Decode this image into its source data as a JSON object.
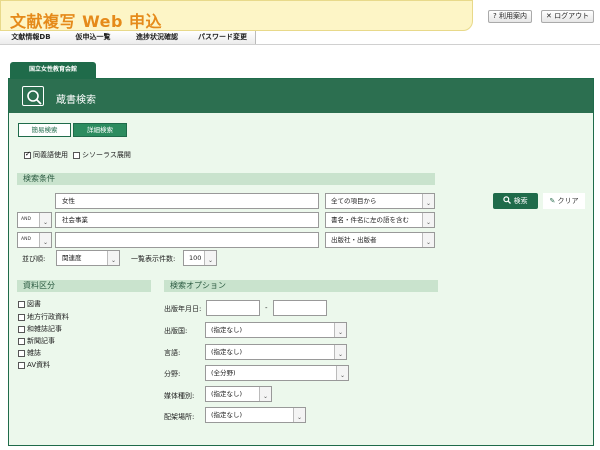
{
  "header": {
    "title": "文献複写 Web 申込",
    "help_label": "利用案内",
    "logout_label": "ログアウト"
  },
  "nav": {
    "items": [
      {
        "label": "文献情報DB"
      },
      {
        "label": "仮申込一覧"
      },
      {
        "label": "進捗状況確認"
      },
      {
        "label": "パスワード変更"
      }
    ]
  },
  "library_tab": "国立女性教育会館",
  "panel_title": "蔵書検索",
  "mode": {
    "simple_label": "簡易検索",
    "advanced_label": "詳細検索",
    "active": "advanced"
  },
  "options": {
    "synonym_label": "同義語使用",
    "synonym_checked": true,
    "thesaurus_label": "シソーラス展開",
    "thesaurus_checked": false
  },
  "conditions": {
    "section_label": "検索条件",
    "rows": [
      {
        "operator": "",
        "value": "女性",
        "field": "全ての項目から"
      },
      {
        "operator": "AND",
        "value": "社会事業",
        "field": "書名・件名に左の語を含む"
      },
      {
        "operator": "AND",
        "value": "",
        "field": "出版社・出版者"
      }
    ],
    "sort_label": "並び順:",
    "sort_value": "関連度",
    "count_label": "一覧表示件数:",
    "count_value": "100",
    "search_label": "検索",
    "clear_label": "クリア"
  },
  "material": {
    "section_label": "資料区分",
    "items": [
      {
        "label": "図書",
        "checked": false
      },
      {
        "label": "地方行政資料",
        "checked": false
      },
      {
        "label": "和雑誌記事",
        "checked": false
      },
      {
        "label": "新聞記事",
        "checked": false
      },
      {
        "label": "雑誌",
        "checked": false
      },
      {
        "label": "AV資料",
        "checked": false
      }
    ]
  },
  "search_options": {
    "section_label": "検索オプション",
    "pub_year_label": "出版年月日:",
    "pub_year_from": "",
    "pub_year_to": "",
    "pub_year_sep": "-",
    "country_label": "出版国:",
    "country_value": "(指定なし)",
    "language_label": "言語:",
    "language_value": "(指定なし)",
    "field_label": "分野:",
    "field_value": "(全分野)",
    "media_label": "媒体種別:",
    "media_value": "(指定なし)",
    "location_label": "配架場所:",
    "location_value": "(指定なし)"
  },
  "colors": {
    "brand_green": "#1f6b4a",
    "banner_bg": "#fdf5c6",
    "title_orange": "#e58a1a",
    "panel_bg": "#ecf8ec",
    "section_bg": "#c9e3cd"
  }
}
